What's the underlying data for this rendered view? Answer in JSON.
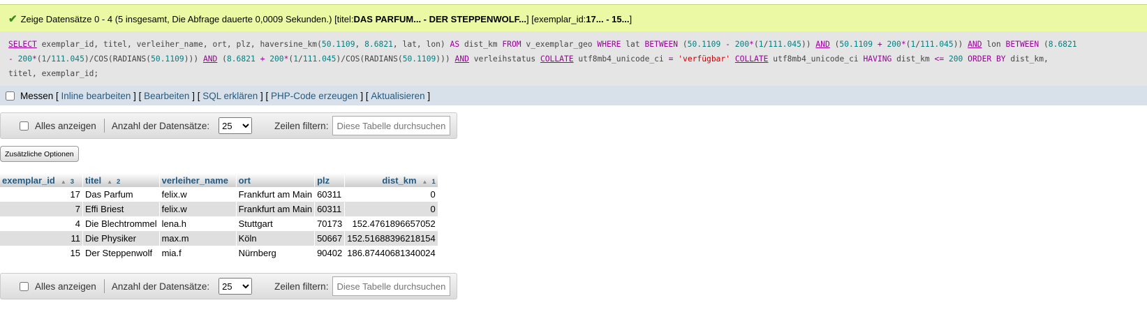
{
  "message": {
    "prefix": "Zeige Datensätze 0 - 4 (5 insgesamt, Die Abfrage dauerte 0,0009 Sekunden.) [titel: ",
    "titel_range": "DAS PARFUM... - DER STEPPENWOLF...",
    "middle": "] [exemplar_id: ",
    "id_range": "17... - 15...",
    "suffix": "]"
  },
  "sql": {
    "line1": "SELECT exemplar_id, titel, verleiher_name, ort, plz, haversine_km(50.1109, 8.6821, lat, lon) AS dist_km FROM v_exemplar_geo WHERE lat BETWEEN (50.1109 - 200*(1/111.045)) AND (50.1109 + 200*(1/111.045)) AND lon BETWEEN (8.6821",
    "line2": "- 200*(1/111.045)/COS(RADIANS(50.1109))) AND (8.6821 + 200*(1/111.045)/COS(RADIANS(50.1109))) AND verleihstatus COLLATE utf8mb4_unicode_ci = 'verfügbar' COLLATE utf8mb4_unicode_ci HAVING dist_km <= 200 ORDER BY dist_km,",
    "line3": "titel, exemplar_id;"
  },
  "query_actions": {
    "profiling_label": "Messen",
    "inline_edit": "Inline bearbeiten",
    "edit": "Bearbeiten",
    "explain": "SQL erklären",
    "php_code": "PHP-Code erzeugen",
    "refresh": "Aktualisieren"
  },
  "navigation": {
    "show_all": "Alles anzeigen",
    "rows_label": "Anzahl der Datensätze:",
    "rows_value": "25",
    "filter_label": "Zeilen filtern:",
    "filter_placeholder": "Diese Tabelle durchsuchen"
  },
  "extra_options": "Zusätzliche Optionen",
  "table": {
    "columns": [
      {
        "name": "exemplar_id",
        "sort_order": "3"
      },
      {
        "name": "titel",
        "sort_order": "2"
      },
      {
        "name": "verleiher_name",
        "sort_order": ""
      },
      {
        "name": "ort",
        "sort_order": ""
      },
      {
        "name": "plz",
        "sort_order": ""
      },
      {
        "name": "dist_km",
        "sort_order": "1"
      }
    ],
    "rows": [
      {
        "exemplar_id": "17",
        "titel": "Das Parfum",
        "verleiher_name": "felix.w",
        "ort": "Frankfurt am Main",
        "plz": "60311",
        "dist_km": "0"
      },
      {
        "exemplar_id": "7",
        "titel": "Effi Briest",
        "verleiher_name": "felix.w",
        "ort": "Frankfurt am Main",
        "plz": "60311",
        "dist_km": "0"
      },
      {
        "exemplar_id": "4",
        "titel": "Die Blechtrommel",
        "verleiher_name": "lena.h",
        "ort": "Stuttgart",
        "plz": "70173",
        "dist_km": "152.4761896657052"
      },
      {
        "exemplar_id": "11",
        "titel": "Die Physiker",
        "verleiher_name": "max.m",
        "ort": "Köln",
        "plz": "50667",
        "dist_km": "152.51688396218154"
      },
      {
        "exemplar_id": "15",
        "titel": "Der Steppenwolf",
        "verleiher_name": "mia.f",
        "ort": "Nürnberg",
        "plz": "90402",
        "dist_km": "186.87440681340024"
      }
    ]
  },
  "colors": {
    "success_bg": "#ebf8a4",
    "link": "#235a81",
    "sql_bg": "#e5e5e5",
    "toolbar_bg": "#d8e1ea"
  }
}
